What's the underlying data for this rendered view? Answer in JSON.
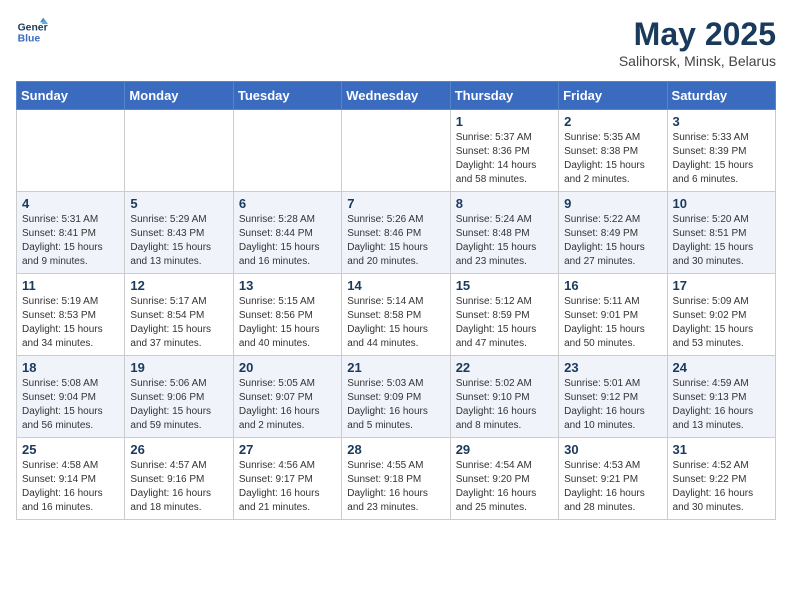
{
  "header": {
    "logo_line1": "General",
    "logo_line2": "Blue",
    "month_title": "May 2025",
    "subtitle": "Salihorsk, Minsk, Belarus"
  },
  "columns": [
    "Sunday",
    "Monday",
    "Tuesday",
    "Wednesday",
    "Thursday",
    "Friday",
    "Saturday"
  ],
  "weeks": [
    [
      {
        "day": "",
        "info": ""
      },
      {
        "day": "",
        "info": ""
      },
      {
        "day": "",
        "info": ""
      },
      {
        "day": "",
        "info": ""
      },
      {
        "day": "1",
        "info": "Sunrise: 5:37 AM\nSunset: 8:36 PM\nDaylight: 14 hours\nand 58 minutes."
      },
      {
        "day": "2",
        "info": "Sunrise: 5:35 AM\nSunset: 8:38 PM\nDaylight: 15 hours\nand 2 minutes."
      },
      {
        "day": "3",
        "info": "Sunrise: 5:33 AM\nSunset: 8:39 PM\nDaylight: 15 hours\nand 6 minutes."
      }
    ],
    [
      {
        "day": "4",
        "info": "Sunrise: 5:31 AM\nSunset: 8:41 PM\nDaylight: 15 hours\nand 9 minutes."
      },
      {
        "day": "5",
        "info": "Sunrise: 5:29 AM\nSunset: 8:43 PM\nDaylight: 15 hours\nand 13 minutes."
      },
      {
        "day": "6",
        "info": "Sunrise: 5:28 AM\nSunset: 8:44 PM\nDaylight: 15 hours\nand 16 minutes."
      },
      {
        "day": "7",
        "info": "Sunrise: 5:26 AM\nSunset: 8:46 PM\nDaylight: 15 hours\nand 20 minutes."
      },
      {
        "day": "8",
        "info": "Sunrise: 5:24 AM\nSunset: 8:48 PM\nDaylight: 15 hours\nand 23 minutes."
      },
      {
        "day": "9",
        "info": "Sunrise: 5:22 AM\nSunset: 8:49 PM\nDaylight: 15 hours\nand 27 minutes."
      },
      {
        "day": "10",
        "info": "Sunrise: 5:20 AM\nSunset: 8:51 PM\nDaylight: 15 hours\nand 30 minutes."
      }
    ],
    [
      {
        "day": "11",
        "info": "Sunrise: 5:19 AM\nSunset: 8:53 PM\nDaylight: 15 hours\nand 34 minutes."
      },
      {
        "day": "12",
        "info": "Sunrise: 5:17 AM\nSunset: 8:54 PM\nDaylight: 15 hours\nand 37 minutes."
      },
      {
        "day": "13",
        "info": "Sunrise: 5:15 AM\nSunset: 8:56 PM\nDaylight: 15 hours\nand 40 minutes."
      },
      {
        "day": "14",
        "info": "Sunrise: 5:14 AM\nSunset: 8:58 PM\nDaylight: 15 hours\nand 44 minutes."
      },
      {
        "day": "15",
        "info": "Sunrise: 5:12 AM\nSunset: 8:59 PM\nDaylight: 15 hours\nand 47 minutes."
      },
      {
        "day": "16",
        "info": "Sunrise: 5:11 AM\nSunset: 9:01 PM\nDaylight: 15 hours\nand 50 minutes."
      },
      {
        "day": "17",
        "info": "Sunrise: 5:09 AM\nSunset: 9:02 PM\nDaylight: 15 hours\nand 53 minutes."
      }
    ],
    [
      {
        "day": "18",
        "info": "Sunrise: 5:08 AM\nSunset: 9:04 PM\nDaylight: 15 hours\nand 56 minutes."
      },
      {
        "day": "19",
        "info": "Sunrise: 5:06 AM\nSunset: 9:06 PM\nDaylight: 15 hours\nand 59 minutes."
      },
      {
        "day": "20",
        "info": "Sunrise: 5:05 AM\nSunset: 9:07 PM\nDaylight: 16 hours\nand 2 minutes."
      },
      {
        "day": "21",
        "info": "Sunrise: 5:03 AM\nSunset: 9:09 PM\nDaylight: 16 hours\nand 5 minutes."
      },
      {
        "day": "22",
        "info": "Sunrise: 5:02 AM\nSunset: 9:10 PM\nDaylight: 16 hours\nand 8 minutes."
      },
      {
        "day": "23",
        "info": "Sunrise: 5:01 AM\nSunset: 9:12 PM\nDaylight: 16 hours\nand 10 minutes."
      },
      {
        "day": "24",
        "info": "Sunrise: 4:59 AM\nSunset: 9:13 PM\nDaylight: 16 hours\nand 13 minutes."
      }
    ],
    [
      {
        "day": "25",
        "info": "Sunrise: 4:58 AM\nSunset: 9:14 PM\nDaylight: 16 hours\nand 16 minutes."
      },
      {
        "day": "26",
        "info": "Sunrise: 4:57 AM\nSunset: 9:16 PM\nDaylight: 16 hours\nand 18 minutes."
      },
      {
        "day": "27",
        "info": "Sunrise: 4:56 AM\nSunset: 9:17 PM\nDaylight: 16 hours\nand 21 minutes."
      },
      {
        "day": "28",
        "info": "Sunrise: 4:55 AM\nSunset: 9:18 PM\nDaylight: 16 hours\nand 23 minutes."
      },
      {
        "day": "29",
        "info": "Sunrise: 4:54 AM\nSunset: 9:20 PM\nDaylight: 16 hours\nand 25 minutes."
      },
      {
        "day": "30",
        "info": "Sunrise: 4:53 AM\nSunset: 9:21 PM\nDaylight: 16 hours\nand 28 minutes."
      },
      {
        "day": "31",
        "info": "Sunrise: 4:52 AM\nSunset: 9:22 PM\nDaylight: 16 hours\nand 30 minutes."
      }
    ]
  ]
}
